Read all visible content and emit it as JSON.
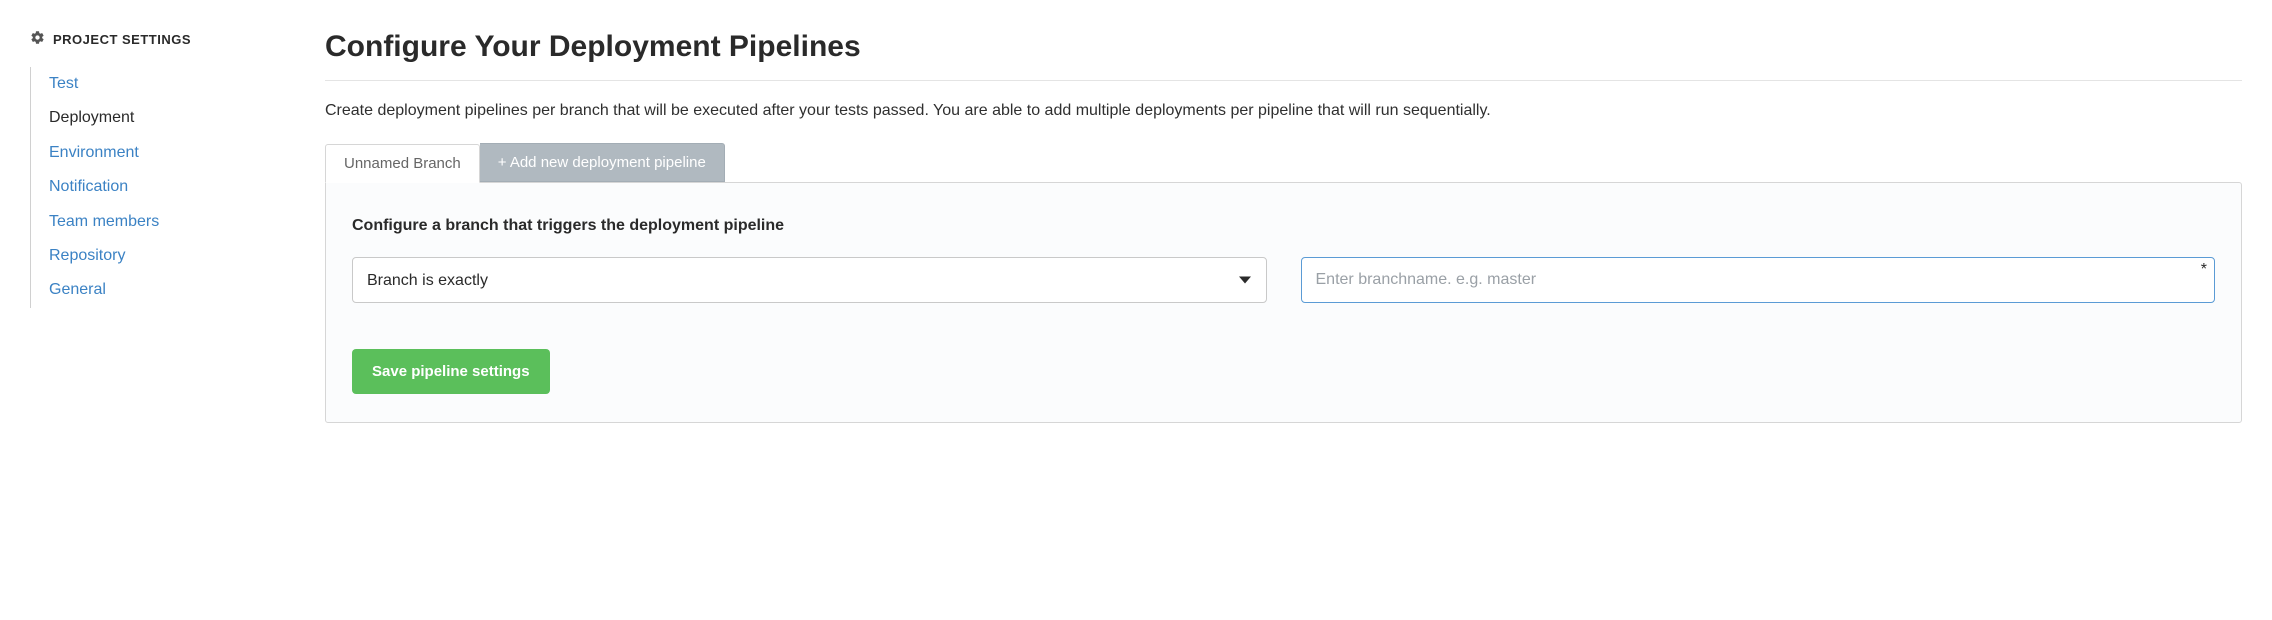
{
  "sidebar": {
    "heading": "PROJECT SETTINGS",
    "items": [
      {
        "label": "Test",
        "active": false
      },
      {
        "label": "Deployment",
        "active": true
      },
      {
        "label": "Environment",
        "active": false
      },
      {
        "label": "Notification",
        "active": false
      },
      {
        "label": "Team members",
        "active": false
      },
      {
        "label": "Repository",
        "active": false
      },
      {
        "label": "General",
        "active": false
      }
    ]
  },
  "main": {
    "title": "Configure Your Deployment Pipelines",
    "description": "Create deployment pipelines per branch that will be executed after your tests passed. You are able to add multiple deployments per pipeline that will run sequentially.",
    "tabs": {
      "active_label": "Unnamed Branch",
      "add_label": "+ Add new deployment pipeline"
    },
    "section_heading": "Configure a branch that triggers the deployment pipeline",
    "branch_condition": {
      "selected": "Branch is exactly"
    },
    "branch_input": {
      "value": "",
      "placeholder": "Enter branchname. e.g. master"
    },
    "save_button_label": "Save pipeline settings"
  }
}
